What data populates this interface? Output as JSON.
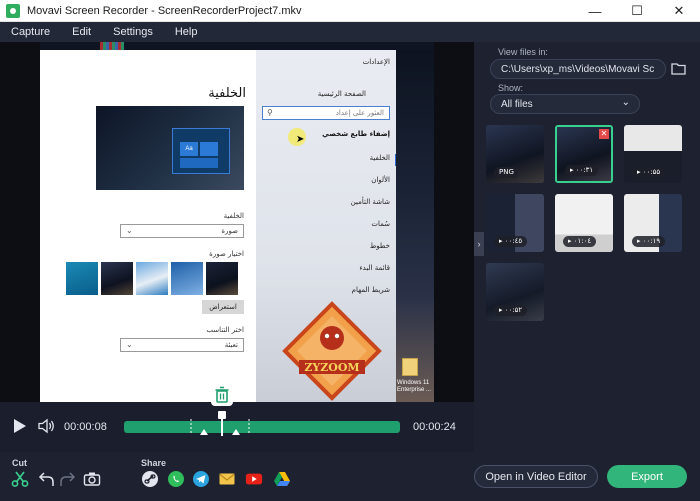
{
  "window": {
    "title": "Movavi Screen Recorder - ScreenRecorderProject7.mkv",
    "minimize_glyph": "—",
    "maximize_glyph": "☐",
    "close_glyph": "✕"
  },
  "menu": [
    "Capture",
    "Edit",
    "Settings",
    "Help"
  ],
  "preview": {
    "settings_title": "الإعدادات",
    "home": "الصفحة الرئيسية",
    "search_placeholder": "العثور على إعداد",
    "personalization": "إضفاء طابع شخصي",
    "nav_items": [
      "الخلفية",
      "الألوان",
      "شاشة التأمين",
      "سُمات",
      "خطوط",
      "قائمة البدء",
      "شريط المهام"
    ],
    "heading": "الخلفية",
    "preview_tile_text": "Aa",
    "background_label": "الخلفية",
    "background_value": "صورة",
    "choose_picture_label": "اختيار صورة",
    "browse_button": "استعراض",
    "choose_fit_label": "اختر التناسب",
    "fit_value": "تعبئة",
    "logo_text": "ZYZOOM",
    "desktop_icon_label": "Windows 11 Enterprise ..."
  },
  "files_panel": {
    "view_files_label": "View files in:",
    "path": "C:\\Users\\xp_ms\\Videos\\Movavi Sc",
    "show_label": "Show:",
    "show_value": "All files",
    "thumbnails": [
      {
        "badge": "PNG",
        "selected": false
      },
      {
        "badge": "▸ ۰۰:۳۱",
        "selected": true
      },
      {
        "badge": "▸ ۰۰:۵۵",
        "selected": false
      },
      {
        "badge": "▸ ۰۰:٤٥",
        "selected": false
      },
      {
        "badge": "▸ ۰۱:۰٤",
        "selected": false
      },
      {
        "badge": "▸ ۰۰:۱۹",
        "selected": false
      },
      {
        "badge": "▸ ۰۰:۵۲",
        "selected": false
      }
    ],
    "delete_glyph": "✕"
  },
  "timeline": {
    "current_time": "00:00:08",
    "total_time": "00:00:24",
    "position_fraction": 0.35
  },
  "bottom": {
    "cut_label": "Cut",
    "share_label": "Share",
    "open_editor": "Open in Video Editor",
    "export": "Export"
  },
  "colors": {
    "accent": "#31b57a",
    "panel_bg": "#1e2230",
    "selected_border": "#39d08f"
  }
}
